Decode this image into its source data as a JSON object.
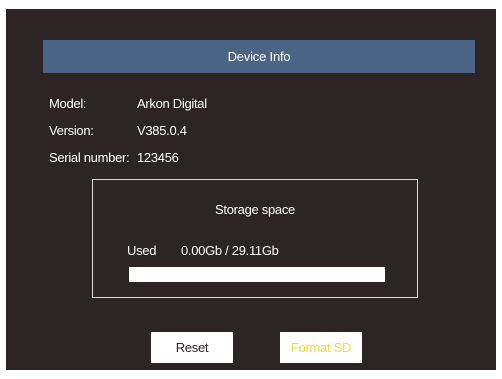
{
  "header": {
    "title": "Device Info"
  },
  "device": {
    "model_label": "Model:",
    "model_value": "Arkon Digital",
    "version_label": "Version:",
    "version_value": "V385.0.4",
    "serial_label": "Serial number:",
    "serial_value": "123456"
  },
  "storage": {
    "title": "Storage space",
    "used_label": "Used",
    "used_value": "0.00Gb / 29.11Gb",
    "used_fraction": 0.0
  },
  "actions": {
    "reset_label": "Reset",
    "format_label": "Format SD"
  },
  "colors": {
    "background": "#2c2425",
    "title_bar": "#4b6384",
    "text": "#ffffff",
    "format_text": "#f3d93c"
  }
}
